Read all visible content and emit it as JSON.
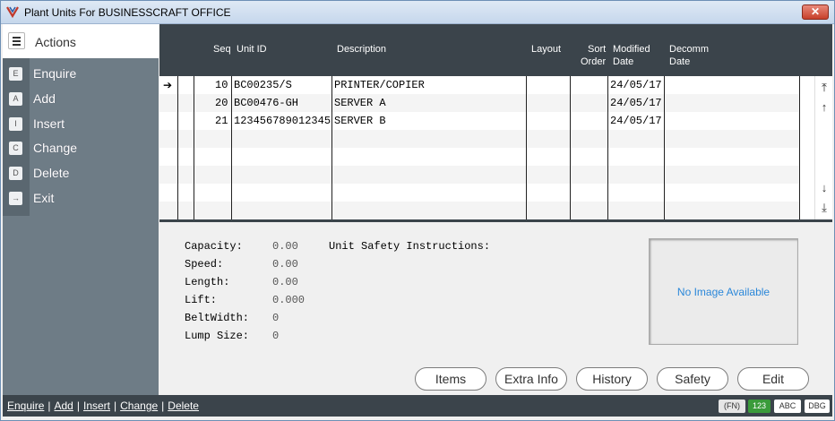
{
  "window": {
    "title": "Plant Units For BUSINESSCRAFT OFFICE",
    "close_label": "✕"
  },
  "sidebar": {
    "header_label": "Actions",
    "items": [
      {
        "key": "E",
        "label": "Enquire"
      },
      {
        "key": "A",
        "label": "Add"
      },
      {
        "key": "I",
        "label": "Insert"
      },
      {
        "key": "C",
        "label": "Change"
      },
      {
        "key": "D",
        "label": "Delete"
      },
      {
        "key": "→",
        "label": "Exit"
      }
    ]
  },
  "grid": {
    "headers": {
      "seq": "Seq",
      "unit_id": "Unit ID",
      "description": "Description",
      "layout": "Layout",
      "sort_order_1": "Sort",
      "sort_order_2": "Order",
      "modified_1": "Modified",
      "modified_2": "Date",
      "decomm_1": "Decomm",
      "decomm_2": "Date"
    },
    "rows": [
      {
        "seq": "10",
        "unit_id": "BC00235/S",
        "description": "PRINTER/COPIER",
        "layout": "",
        "sort_order": "",
        "modified": "24/05/17",
        "decomm": ""
      },
      {
        "seq": "20",
        "unit_id": "BC00476-GH",
        "description": "SERVER A",
        "layout": "",
        "sort_order": "",
        "modified": "24/05/17",
        "decomm": ""
      },
      {
        "seq": "21",
        "unit_id": "123456789012345",
        "description": "SERVER B",
        "layout": "",
        "sort_order": "",
        "modified": "24/05/17",
        "decomm": ""
      }
    ],
    "current_row_marker": "➔"
  },
  "detail": {
    "fields": [
      {
        "label": "Capacity:",
        "value": "0.00"
      },
      {
        "label": "Speed:",
        "value": "0.00"
      },
      {
        "label": "Length:",
        "value": "0.00"
      },
      {
        "label": "Lift:",
        "value": "0.000"
      },
      {
        "label": "BeltWidth:",
        "value": "0"
      },
      {
        "label": "Lump Size:",
        "value": "0"
      }
    ],
    "safety_label": "Unit Safety Instructions:",
    "no_image_text": "No Image Available"
  },
  "buttons": {
    "items": "Items",
    "extra_info": "Extra Info",
    "history": "History",
    "safety": "Safety",
    "edit": "Edit"
  },
  "statusbar": {
    "links": [
      "Enquire",
      "Add",
      "Insert",
      "Change",
      "Delete"
    ],
    "separator": "|",
    "badges": {
      "fn": "(FN)",
      "num": "123",
      "abc": "ABC",
      "dbg": "DBG"
    }
  },
  "colors": {
    "accent_blue": "#2a87d9",
    "num_badge_green": "#3a9b3a",
    "dark_header": "#3b444b",
    "sidebar_gray": "#6e7c86"
  }
}
